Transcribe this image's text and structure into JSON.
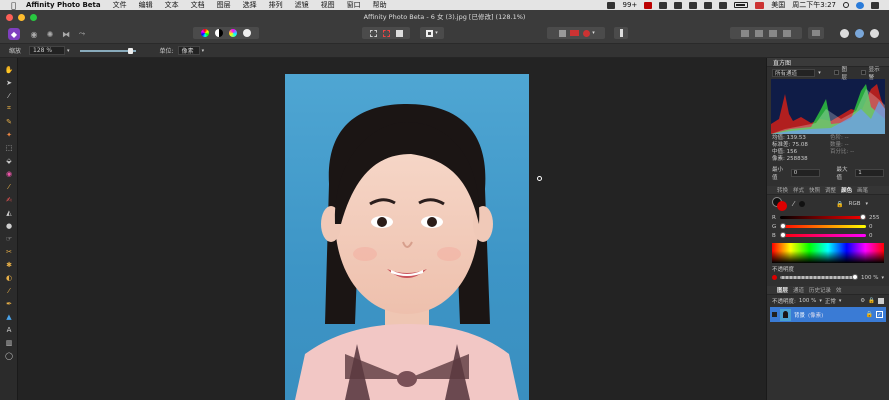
{
  "menubar": {
    "app_name": "Affinity Photo Beta",
    "menus": [
      "文件",
      "编辑",
      "文本",
      "文档",
      "图层",
      "选择",
      "排列",
      "滤镜",
      "视图",
      "窗口",
      "帮助"
    ],
    "status": {
      "notifications": "99+",
      "input_method": "美国",
      "datetime": "周二下午3:27"
    }
  },
  "window": {
    "title": "Affinity Photo Beta - 6 女 (3).jpg [已修改] (128.1%)"
  },
  "context_bar": {
    "zoom_label": "缩放",
    "zoom_value": "128 %",
    "unit_label": "单位:",
    "unit_value": "像素"
  },
  "histogram": {
    "panel_title": "直方图",
    "channel": "所有通道",
    "layer_option": "图层",
    "warnings_option": "显示警",
    "stats": {
      "mean_label": "均值:",
      "mean": "139.53",
      "std_label": "标准差:",
      "std": "75.08",
      "median_label": "中值:",
      "median": "156",
      "pixels_label": "像素:",
      "pixels": "258838",
      "level_label": "色阶:",
      "level": "--",
      "count_label": "数量:",
      "count": "--",
      "percentile_label": "百分比:",
      "percentile": "--"
    },
    "min_label": "最小值",
    "min_value": "0",
    "max_label": "最大值",
    "max_value": "1"
  },
  "color": {
    "tabs": [
      "转换",
      "样式",
      "快照",
      "调整",
      "颜色",
      "画笔"
    ],
    "active_tab": "颜色",
    "mode": "RGB",
    "r": 255,
    "g": 0,
    "b": 0,
    "r_label": "R",
    "g_label": "G",
    "b_label": "B",
    "opacity_label": "不透明度",
    "opacity_value": "100 %"
  },
  "layers": {
    "tabs": [
      "图层",
      "通道",
      "历史记录",
      "效"
    ],
    "opacity_label": "不透明度:",
    "opacity_value": "100 %",
    "blend_mode": "正常",
    "items": [
      {
        "name": "背景",
        "type": "(像素)"
      }
    ]
  },
  "colors": {
    "accent": "#3a7bd5",
    "swatch_primary": "#dd0000",
    "photo_bg": "#4aa2d0"
  }
}
